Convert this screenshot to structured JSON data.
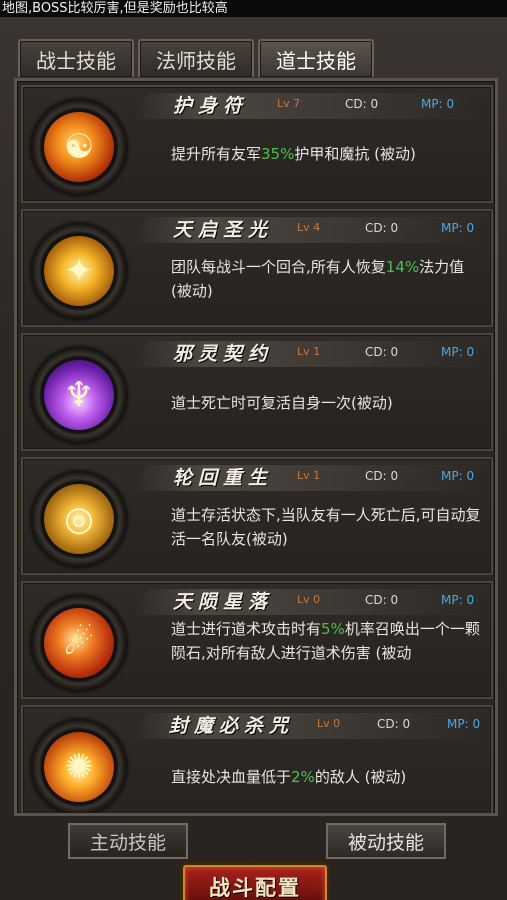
{
  "top_notice": "地图,BOSS比较厉害,但是奖励也比较高",
  "tabs": [
    "战士技能",
    "法师技能",
    "道士技能"
  ],
  "active_tab": 2,
  "skills": [
    {
      "name": "护身符",
      "lv": "Lv 7",
      "cd": "CD: 0",
      "mp": "MP: 0",
      "icon": "taiji-icon",
      "desc_parts": [
        "提升所有友军",
        "35%",
        "护甲和魔抗 (被动)"
      ]
    },
    {
      "name": "天启圣光",
      "lv": "Lv 4",
      "cd": "CD: 0",
      "mp": "MP: 0",
      "icon": "holy-light-icon",
      "desc_parts": [
        "团队每战斗一个回合,所有人恢复",
        "14%",
        "法力值 (被动)"
      ]
    },
    {
      "name": "邪灵契约",
      "lv": "Lv 1",
      "cd": "CD: 0",
      "mp": "MP: 0",
      "icon": "demon-pact-icon",
      "desc_parts": [
        "道士死亡时可复活自身一次(被动)",
        "",
        ""
      ]
    },
    {
      "name": "轮回重生",
      "lv": "Lv 1",
      "cd": "CD: 0",
      "mp": "MP: 0",
      "icon": "rebirth-icon",
      "desc_parts": [
        "道士存活状态下,当队友有一人死亡后,可自动复活一名队友(被动)",
        "",
        ""
      ]
    },
    {
      "name": "天陨星落",
      "lv": "Lv 0",
      "cd": "CD: 0",
      "mp": "MP: 0",
      "icon": "meteor-icon",
      "desc_parts": [
        "道士进行道术攻击时有",
        "5%",
        "机率召唤出一个一颗陨石,对所有敌人进行道术伤害 (被动"
      ]
    },
    {
      "name": "封魔必杀咒",
      "lv": "Lv 0",
      "cd": "CD: 0",
      "mp": "MP: 0",
      "icon": "seal-curse-icon",
      "desc_parts": [
        "直接处决血量低于",
        "2%",
        "的敌人 (被动)"
      ]
    }
  ],
  "bottom": {
    "active_skills": "主动技能",
    "passive_skills": "被动技能",
    "battle_config": "战斗配置"
  },
  "colors": {
    "highlight": "#4cc04c",
    "level": "#c7783b",
    "mp": "#4aa8e8"
  }
}
